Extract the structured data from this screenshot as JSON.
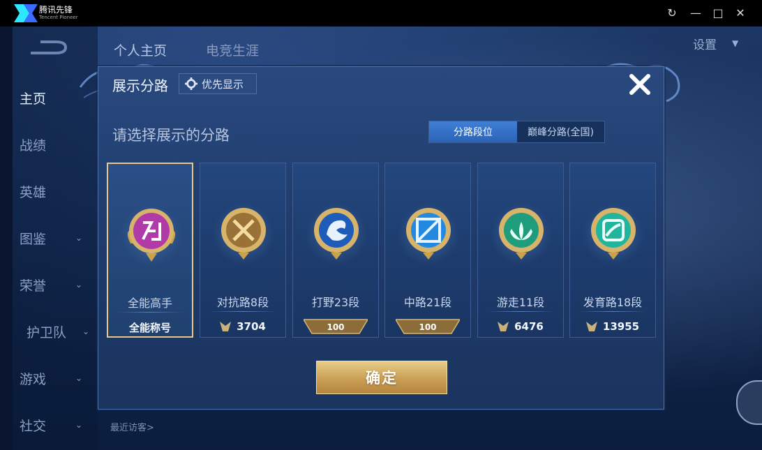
{
  "window": {
    "app_name": "腾讯先锋",
    "app_subtitle": "Tencent Pioneer",
    "buttons": [
      "refresh",
      "minimize",
      "maximize",
      "close"
    ]
  },
  "background": {
    "top_tabs": [
      "个人主页",
      "电竞生涯"
    ],
    "settings_label": "设置",
    "sidebar": [
      {
        "label": "主页",
        "active": true
      },
      {
        "label": "战绩"
      },
      {
        "label": "英雄"
      },
      {
        "label": "图鉴"
      },
      {
        "label": "荣誉"
      },
      {
        "label": "护卫队"
      },
      {
        "label": "游戏"
      },
      {
        "label": "社交"
      }
    ],
    "recent_visitors": "最近访客>"
  },
  "modal": {
    "title": "展示分路",
    "priority_button": "优先显示",
    "subtitle": "请选择展示的分路",
    "segments": [
      {
        "label": "分路段位",
        "active": true
      },
      {
        "label": "巅峰分路(全国)",
        "active": false
      }
    ],
    "cards": [
      {
        "label": "全能高手",
        "footer": "全能称号",
        "type": "title",
        "selected": true,
        "badge_color": "#c548c0"
      },
      {
        "label": "对抗路8段",
        "footer": "3704",
        "type": "score",
        "badge_color": "#c9a24e"
      },
      {
        "label": "打野23段",
        "footer": "100",
        "type": "hundred",
        "badge_color": "#2b6fd4"
      },
      {
        "label": "中路21段",
        "footer": "100",
        "type": "hundred",
        "badge_color": "#2a8fe0"
      },
      {
        "label": "游走11段",
        "footer": "6476",
        "type": "score",
        "badge_color": "#2fae8b"
      },
      {
        "label": "发育路18段",
        "footer": "13955",
        "type": "score",
        "badge_color": "#2cc0a8"
      }
    ],
    "confirm_label": "确定"
  }
}
